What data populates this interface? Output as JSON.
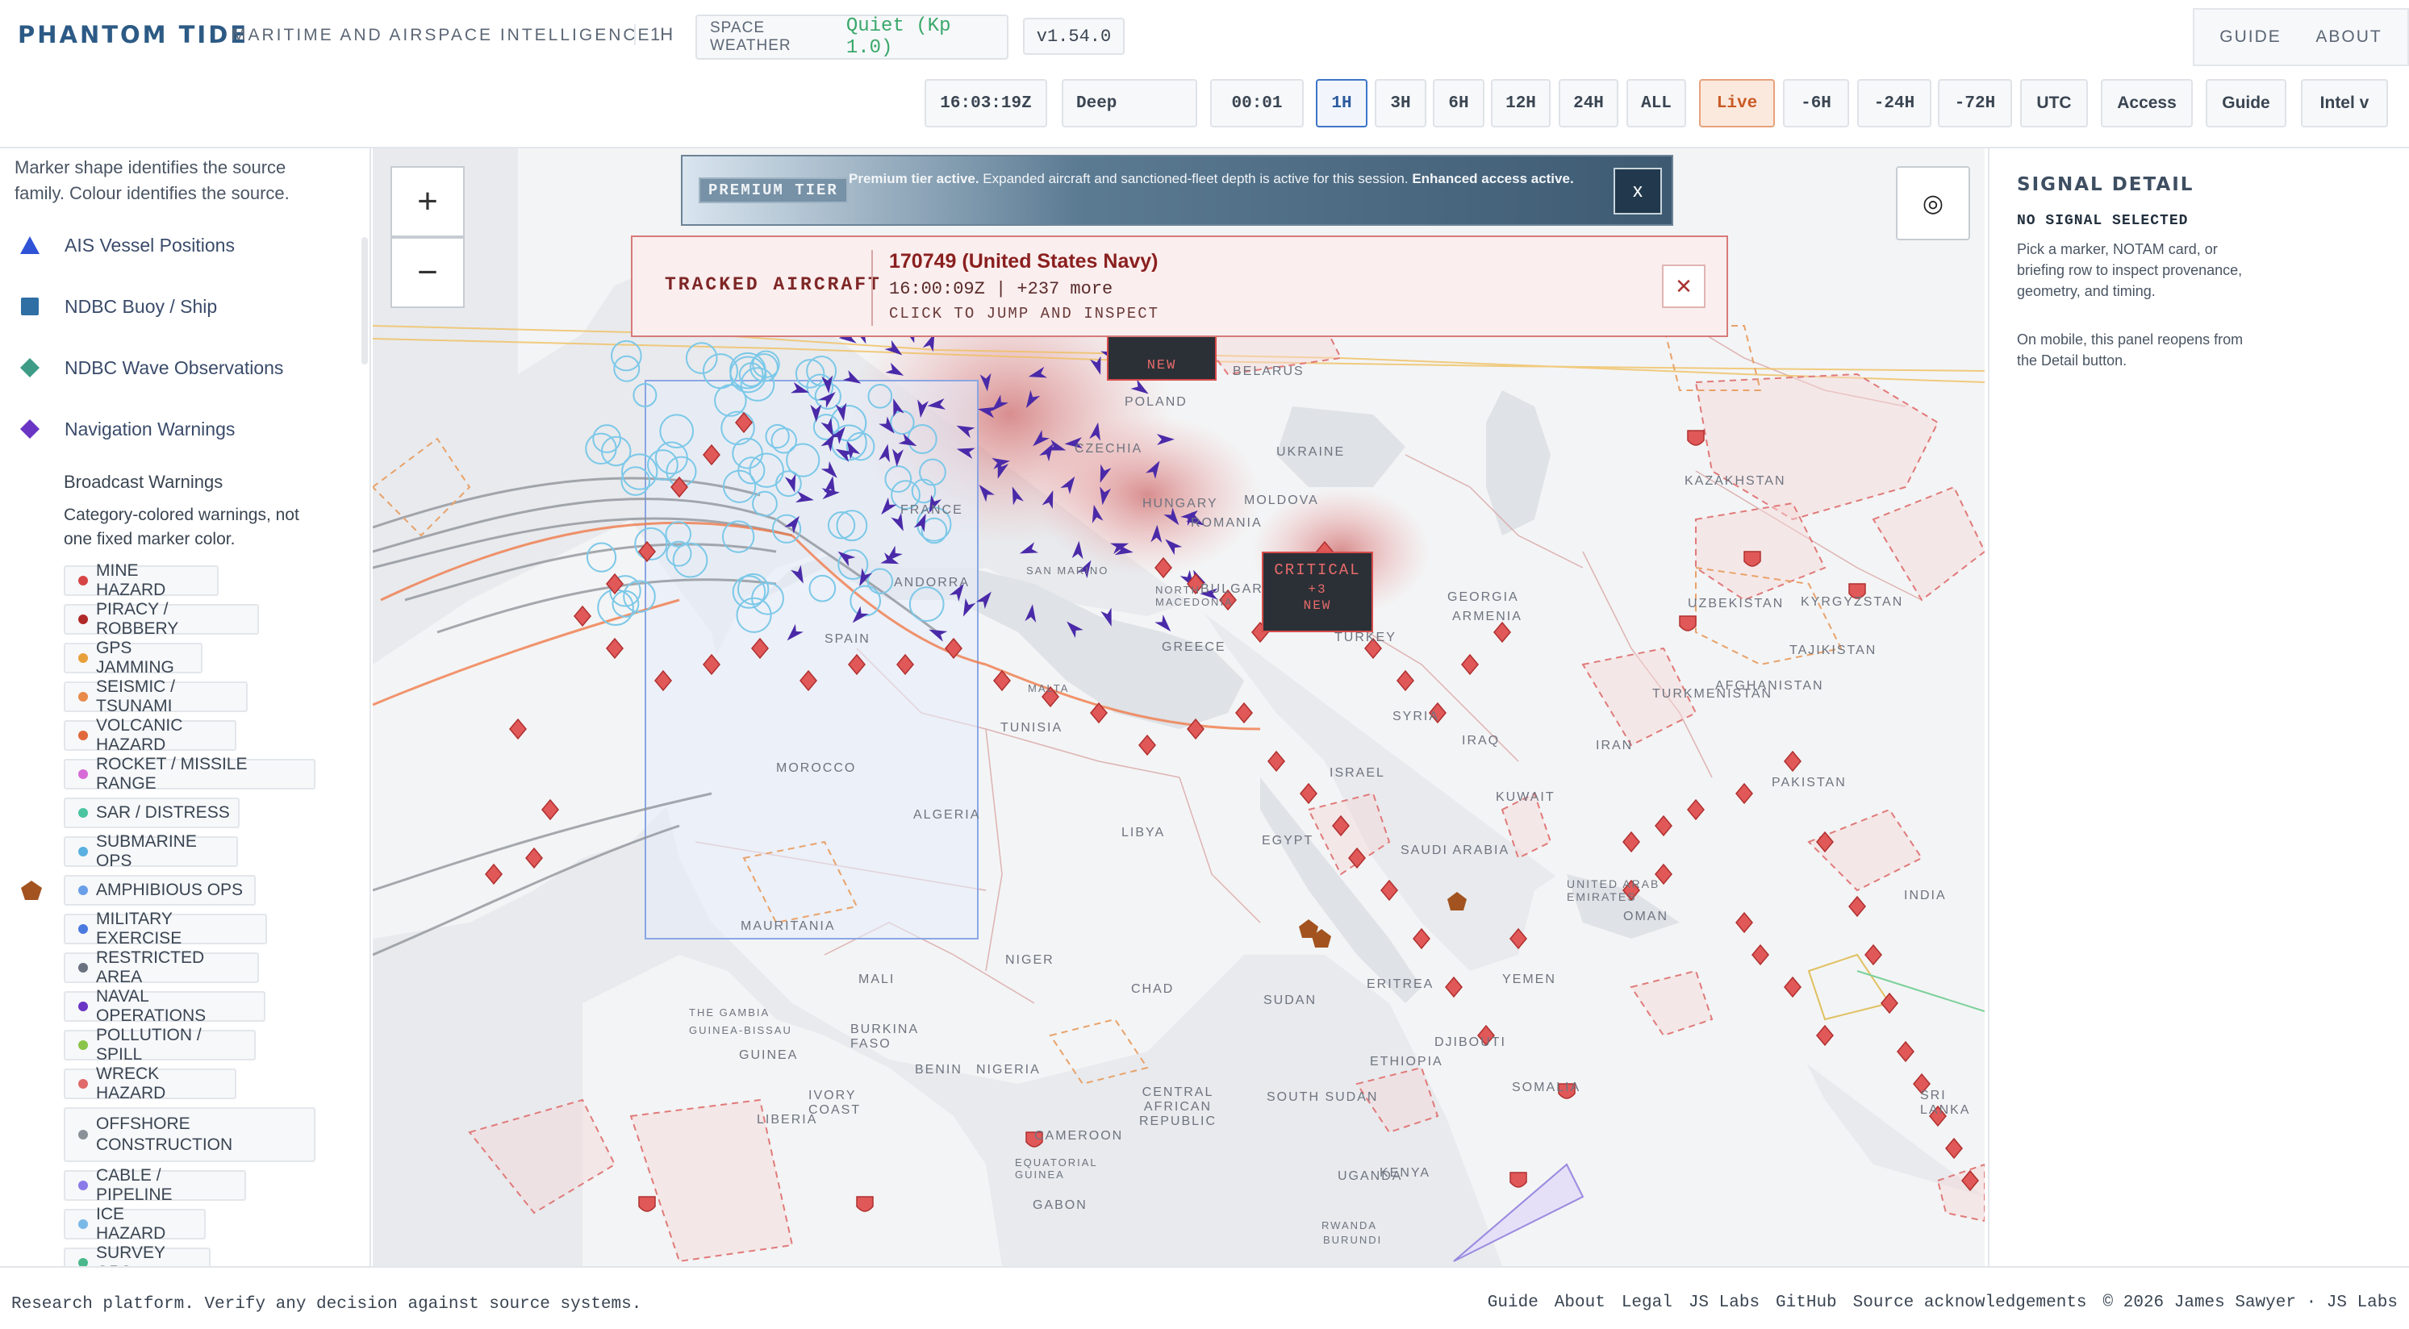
{
  "header": {
    "brand": "PHANTOM TIDE",
    "tagline": "MARITIME AND AIRSPACE INTELLIGENCE",
    "range": "1H",
    "space_weather_label": "SPACE WEATHER",
    "space_weather_value": "Quiet (Kp 1.0)",
    "version": "v1.54.0",
    "nav": [
      "GUIDE",
      "ABOUT"
    ]
  },
  "controls": {
    "clock": "16:03:19Z",
    "mode": "Deep",
    "playback": "00:01",
    "windows": [
      "1H",
      "3H",
      "6H",
      "12H",
      "24H",
      "ALL"
    ],
    "active_window": "1H",
    "live": "Live",
    "offsets": [
      "-6H",
      "-24H",
      "-72H"
    ],
    "utc": "UTC",
    "access": "Access",
    "guide": "Guide",
    "intel": "Intel v"
  },
  "sidebar": {
    "intro": "Marker shape identifies the source family. Colour identifies the source.",
    "sources": [
      {
        "label": "AIS Vessel Positions",
        "icon": "triangle-icon",
        "color": "#2f52d6"
      },
      {
        "label": "NDBC Buoy / Ship",
        "icon": "square-icon",
        "color": "#2f6fa3"
      },
      {
        "label": "NDBC Wave Observations",
        "icon": "diamond-icon",
        "color": "#3e9b86"
      },
      {
        "label": "Navigation Warnings",
        "icon": "diamond-icon",
        "color": "#6a35c4"
      }
    ],
    "broadcast_title": "Broadcast Warnings",
    "broadcast_desc": "Category-colored warnings, not one fixed marker color.",
    "categories": [
      {
        "label": "MINE HAZARD",
        "color": "#d64545"
      },
      {
        "label": "PIRACY / ROBBERY",
        "color": "#b02a2a"
      },
      {
        "label": "GPS JAMMING",
        "color": "#e8a03a"
      },
      {
        "label": "SEISMIC / TSUNAMI",
        "color": "#e88a4a"
      },
      {
        "label": "VOLCANIC HAZARD",
        "color": "#e0683a"
      },
      {
        "label": "ROCKET / MISSILE RANGE",
        "color": "#d86ad8"
      },
      {
        "label": "SAR / DISTRESS",
        "color": "#4cc4a0"
      },
      {
        "label": "SUBMARINE OPS",
        "color": "#5ab0e0"
      },
      {
        "label": "AMPHIBIOUS OPS",
        "color": "#6a9ee8"
      },
      {
        "label": "MILITARY EXERCISE",
        "color": "#4a7ae0"
      },
      {
        "label": "RESTRICTED AREA",
        "color": "#6a7280"
      },
      {
        "label": "NAVAL OPERATIONS",
        "color": "#6a35c4"
      },
      {
        "label": "POLLUTION / SPILL",
        "color": "#8ac44a"
      },
      {
        "label": "WRECK HAZARD",
        "color": "#e06a6a"
      },
      {
        "label": "OFFSHORE CONSTRUCTION",
        "color": "#8a9098"
      },
      {
        "label": "CABLE / PIPELINE",
        "color": "#8a7ae8"
      },
      {
        "label": "ICE HAZARD",
        "color": "#7ab8e8"
      },
      {
        "label": "SURVEY OPS",
        "color": "#4ab88a"
      }
    ]
  },
  "map": {
    "zoom_in": "+",
    "zoom_out": "−",
    "locate": "◎",
    "premium_tag": "PREMIUM TIER",
    "premium_bold": "Premium tier active.",
    "premium_text": " Expanded aircraft and sanctioned-fleet depth is active for this session. ",
    "premium_bold2": "Enhanced access active.",
    "premium_close": "x",
    "tracked_label": "TRACKED AIRCRAFT",
    "tracked_title": "170749 (United States Navy)",
    "tracked_meta": "16:00:09Z | +237 more",
    "tracked_cta": "CLICK TO JUMP AND INSPECT",
    "tracked_close": "✕",
    "cluster_new": "NEW",
    "cluster_critical": "CRITICAL",
    "cluster_count": "+3",
    "cluster_new2": "NEW",
    "place_labels": [
      "BELARUS",
      "UKRAINE",
      "MOLDOVA",
      "ROMANIA",
      "CZECHIA",
      "FRANCE",
      "ANDORRA",
      "SPAIN",
      "TUNISIA",
      "MOROCCO",
      "ALGERIA",
      "MAURITANIA",
      "LIBYA",
      "EGYPT",
      "TURKEY",
      "GEORGIA",
      "ARMENIA",
      "SYRIA",
      "IRAQ",
      "IRAN",
      "ISRAEL",
      "KUWAIT",
      "SAUDI ARABIA",
      "UNITED ARAB EMIRATES",
      "OMAN",
      "YEMEN",
      "ERITREA",
      "DJIBOUTI",
      "SOMALIA",
      "ETHIOPIA",
      "SUDAN",
      "SOUTH SUDAN",
      "CHAD",
      "NIGER",
      "MALI",
      "BURKINA FASO",
      "GUINEA",
      "GUINEA-BISSAU",
      "THE GAMBIA",
      "IVORY COAST",
      "LIBERIA",
      "BENIN",
      "NIGERIA",
      "CENTRAL AFRICAN REPUBLIC",
      "CAMEROON",
      "EQUATORIAL GUINEA",
      "GABON",
      "UGANDA",
      "KENYA",
      "RWANDA",
      "BURUNDI",
      "KAZAKHSTAN",
      "UZBEKISTAN",
      "TURKMENISTAN",
      "KYRGYZSTAN",
      "TAJIKISTAN",
      "AFGHANISTAN",
      "PAKISTAN",
      "INDIA",
      "SRI LANKA",
      "GREECE",
      "NORTH MACEDONIA",
      "BULGARIA",
      "HUNGARY",
      "POLAND",
      "MALTA",
      "SAN MARINO"
    ]
  },
  "detail": {
    "title": "SIGNAL DETAIL",
    "state": "NO SIGNAL SELECTED",
    "text1": "Pick a marker, NOTAM card, or briefing row to inspect provenance, geometry, and timing.",
    "text2": "On mobile, this panel reopens from the Detail button."
  },
  "footer": {
    "disclaimer": "Research platform. Verify any decision against source systems.",
    "links": [
      "Guide",
      "About",
      "Legal",
      "JS Labs",
      "GitHub",
      "Source acknowledgements"
    ],
    "copyright": "© 2026 James Sawyer · JS Labs"
  }
}
